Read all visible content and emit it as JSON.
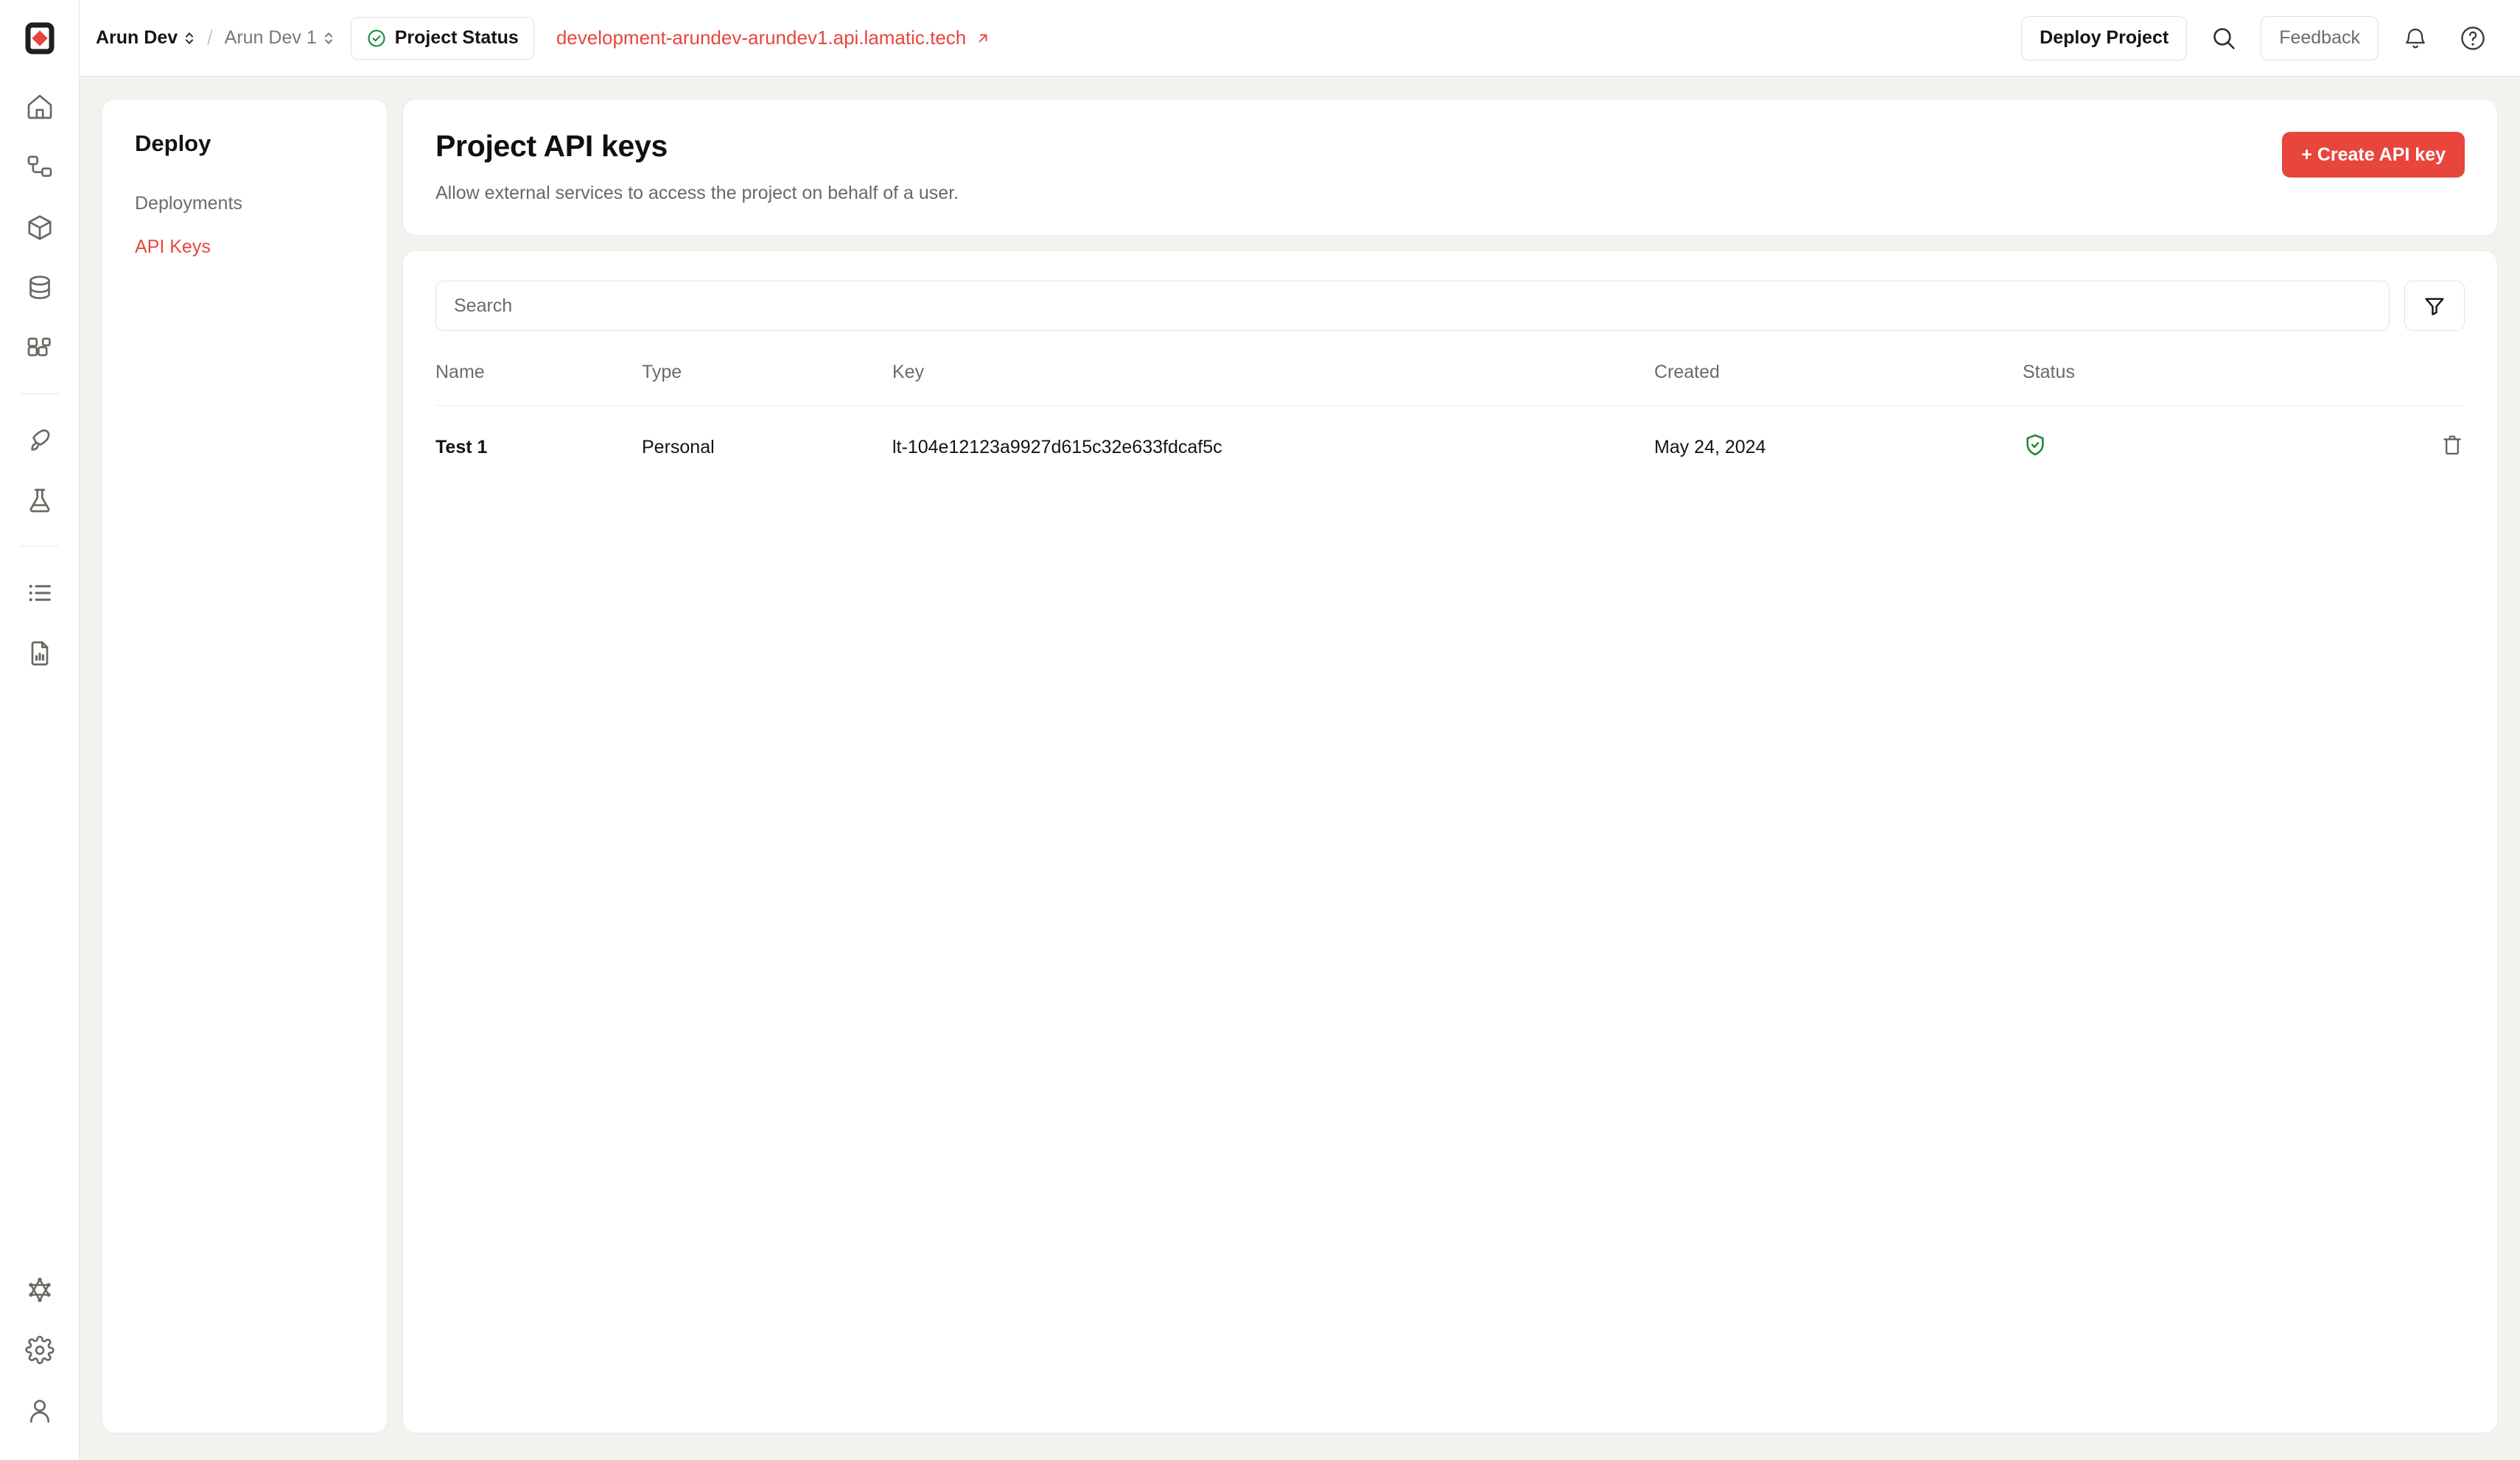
{
  "brand": {
    "logo_icon": "lamatic-diamond-logo",
    "accent_color": "#e8453c",
    "surface_color": "#ffffff",
    "page_background": "#f3f2ee"
  },
  "topbar": {
    "org_name": "Arun Dev",
    "separator": "/",
    "project_name": "Arun Dev 1",
    "status_pill": {
      "icon": "check-circle-icon",
      "label": "Project Status",
      "icon_color": "#19893a"
    },
    "domain_link": {
      "label": "development-arundev-arundev1.api.lamatic.tech",
      "icon": "external-link-icon",
      "color": "#e8453c"
    },
    "deploy_button": "Deploy Project",
    "search_icon": "search-icon",
    "feedback_button": "Feedback",
    "notifications_icon": "bell-icon",
    "help_icon": "help-circle-icon"
  },
  "rail": {
    "items": [
      {
        "icon": "home-icon",
        "name": "home"
      },
      {
        "icon": "workflow-icon",
        "name": "flows"
      },
      {
        "icon": "cube-icon",
        "name": "models"
      },
      {
        "icon": "database-icon",
        "name": "data"
      },
      {
        "icon": "apps-grid-icon",
        "name": "apps"
      },
      {
        "icon": "rocket-icon",
        "name": "deploy"
      },
      {
        "icon": "flask-icon",
        "name": "experiments"
      },
      {
        "icon": "list-icon",
        "name": "logs"
      },
      {
        "icon": "file-chart-icon",
        "name": "reports"
      }
    ],
    "bottom_items": [
      {
        "icon": "graphql-icon",
        "name": "graphql"
      },
      {
        "icon": "gear-icon",
        "name": "settings"
      },
      {
        "icon": "user-icon",
        "name": "account"
      }
    ]
  },
  "section_nav": {
    "title": "Deploy",
    "items": [
      {
        "label": "Deployments",
        "active": false
      },
      {
        "label": "API Keys",
        "active": true
      }
    ]
  },
  "page": {
    "title": "Project API keys",
    "subtitle": "Allow external services to access the project on behalf of a user.",
    "create_button": "+ Create API key"
  },
  "toolbar": {
    "search_placeholder": "Search",
    "search_value": "",
    "filter_icon": "funnel-icon"
  },
  "table": {
    "columns": [
      "Name",
      "Type",
      "Key",
      "Created",
      "Status"
    ],
    "rows": [
      {
        "name": "Test 1",
        "type": "Personal",
        "key": "lt-104e12123a9927d615c32e633fdcaf5c",
        "created": "May 24, 2024",
        "status_icon": "shield-check-icon",
        "status_color": "#1f8a32",
        "delete_icon": "trash-icon"
      }
    ]
  }
}
